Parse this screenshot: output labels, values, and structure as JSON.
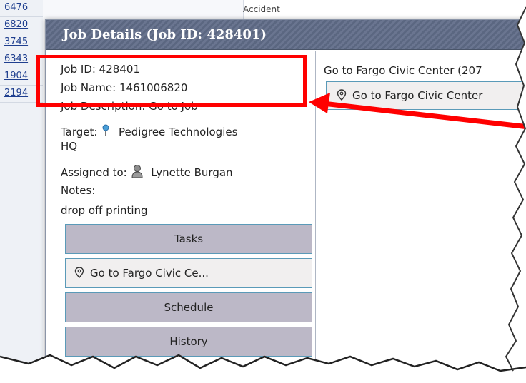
{
  "background": {
    "list_items": [
      "6476",
      "6820",
      "3745",
      "6343",
      "1904",
      "2194"
    ],
    "top_text": "Accident"
  },
  "dialog": {
    "title": "Job Details (Job ID: 428401)",
    "job_id": "Job ID: 428401",
    "job_name": "Job Name: 1461006820",
    "job_description": "Job Description: Go to Job",
    "target_label": "Target:",
    "target_value": "Pedigree Technologies",
    "target_value_2": "HQ",
    "assigned_label": "Assigned to:",
    "assigned_value": "Lynette Burgan",
    "notes_label": "Notes:",
    "notes_value": "drop off printing",
    "buttons": {
      "tasks": "Tasks",
      "location": "Go to Fargo Civic Ce...",
      "schedule": "Schedule",
      "history": "History"
    },
    "right_panel": {
      "title": "Go to Fargo Civic Center (207",
      "location_button": "Go to Fargo Civic Center"
    }
  },
  "colors": {
    "annotation": "#ff0000",
    "title_bar": "#5b6781",
    "button_gray": "#bcb8c7",
    "button_border": "#5a9ab8"
  }
}
